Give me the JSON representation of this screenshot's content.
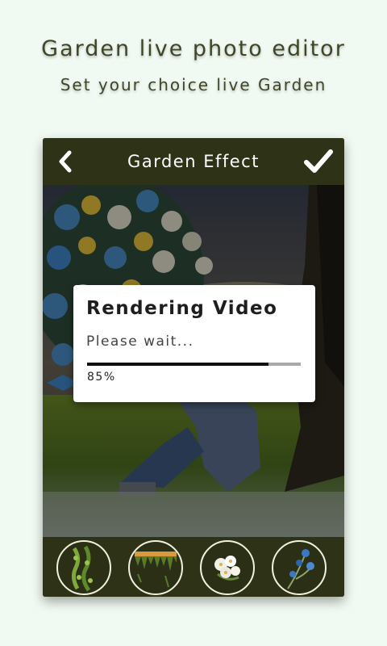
{
  "promo": {
    "title": "Garden live photo editor",
    "subtitle": "Set your choice live Garden"
  },
  "topbar": {
    "title": "Garden Effect",
    "back_icon": "chevron-left-icon",
    "confirm_icon": "checkmark-icon"
  },
  "dialog": {
    "title": "Rendering Video",
    "message": "Please wait...",
    "progress": 0.85,
    "progress_text": "85%"
  },
  "effects": [
    {
      "name": "vine-effect",
      "icon": "vine-icon"
    },
    {
      "name": "grass-border-effect",
      "icon": "grass-border-icon"
    },
    {
      "name": "white-flowers-effect",
      "icon": "white-flowers-icon"
    },
    {
      "name": "blue-flowers-effect",
      "icon": "blue-flowers-icon"
    }
  ],
  "colors": {
    "background": "#f1faf2",
    "bar": "#2e3216",
    "accent_text": "#3f4527"
  }
}
